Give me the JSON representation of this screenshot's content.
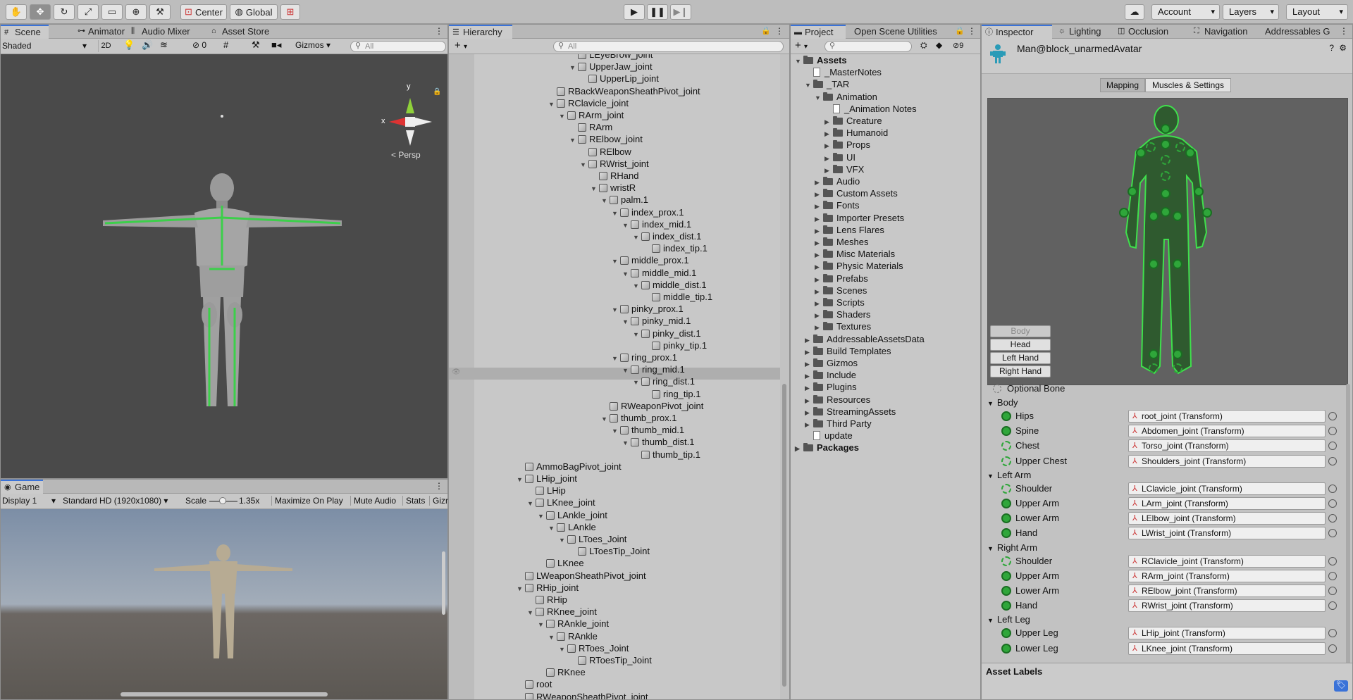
{
  "toolbar": {
    "center_label": "Center",
    "global_label": "Global",
    "account_label": "Account",
    "layers_label": "Layers",
    "layout_label": "Layout"
  },
  "scene": {
    "tabs": [
      "Scene",
      "Animator",
      "Audio Mixer",
      "Asset Store"
    ],
    "shading_mode": "Shaded",
    "mode_2d": "2D",
    "hidden_count": "0",
    "gizmos_label": "Gizmos",
    "search_placeholder": "All",
    "persp_label": "Persp",
    "axis_x": "x",
    "axis_y": "y"
  },
  "game": {
    "tab": "Game",
    "display": "Display 1",
    "resolution": "Standard HD (1920x1080)",
    "scale_label": "Scale",
    "scale_value": "1.35x",
    "maximize": "Maximize On Play",
    "mute": "Mute Audio",
    "stats": "Stats",
    "gizmos": "Gizm"
  },
  "hierarchy": {
    "tab": "Hierarchy",
    "search_placeholder": "All",
    "rows": [
      {
        "label": "LEyeBrow_joint",
        "depth": 9,
        "arrow": ""
      },
      {
        "label": "UpperJaw_joint",
        "depth": 9,
        "arrow": "▼"
      },
      {
        "label": "UpperLip_joint",
        "depth": 10,
        "arrow": ""
      },
      {
        "label": "RBackWeaponSheathPivot_joint",
        "depth": 7,
        "arrow": ""
      },
      {
        "label": "RClavicle_joint",
        "depth": 7,
        "arrow": "▼"
      },
      {
        "label": "RArm_joint",
        "depth": 8,
        "arrow": "▼"
      },
      {
        "label": "RArm",
        "depth": 9,
        "arrow": ""
      },
      {
        "label": "RElbow_joint",
        "depth": 9,
        "arrow": "▼"
      },
      {
        "label": "RElbow",
        "depth": 10,
        "arrow": ""
      },
      {
        "label": "RWrist_joint",
        "depth": 10,
        "arrow": "▼"
      },
      {
        "label": "RHand",
        "depth": 11,
        "arrow": ""
      },
      {
        "label": "wristR",
        "depth": 11,
        "arrow": "▼"
      },
      {
        "label": "palm.1",
        "depth": 12,
        "arrow": "▼"
      },
      {
        "label": "index_prox.1",
        "depth": 13,
        "arrow": "▼"
      },
      {
        "label": "index_mid.1",
        "depth": 14,
        "arrow": "▼"
      },
      {
        "label": "index_dist.1",
        "depth": 15,
        "arrow": "▼"
      },
      {
        "label": "index_tip.1",
        "depth": 16,
        "arrow": ""
      },
      {
        "label": "middle_prox.1",
        "depth": 13,
        "arrow": "▼"
      },
      {
        "label": "middle_mid.1",
        "depth": 14,
        "arrow": "▼"
      },
      {
        "label": "middle_dist.1",
        "depth": 15,
        "arrow": "▼"
      },
      {
        "label": "middle_tip.1",
        "depth": 16,
        "arrow": ""
      },
      {
        "label": "pinky_prox.1",
        "depth": 13,
        "arrow": "▼"
      },
      {
        "label": "pinky_mid.1",
        "depth": 14,
        "arrow": "▼"
      },
      {
        "label": "pinky_dist.1",
        "depth": 15,
        "arrow": "▼"
      },
      {
        "label": "pinky_tip.1",
        "depth": 16,
        "arrow": ""
      },
      {
        "label": "ring_prox.1",
        "depth": 13,
        "arrow": "▼"
      },
      {
        "label": "ring_mid.1",
        "depth": 14,
        "arrow": "▼"
      },
      {
        "label": "ring_dist.1",
        "depth": 15,
        "arrow": "▼"
      },
      {
        "label": "ring_tip.1",
        "depth": 16,
        "arrow": ""
      },
      {
        "label": "RWeaponPivot_joint",
        "depth": 12,
        "arrow": ""
      },
      {
        "label": "thumb_prox.1",
        "depth": 12,
        "arrow": "▼"
      },
      {
        "label": "thumb_mid.1",
        "depth": 13,
        "arrow": "▼"
      },
      {
        "label": "thumb_dist.1",
        "depth": 14,
        "arrow": "▼"
      },
      {
        "label": "thumb_tip.1",
        "depth": 15,
        "arrow": ""
      },
      {
        "label": "AmmoBagPivot_joint",
        "depth": 4,
        "arrow": ""
      },
      {
        "label": "LHip_joint",
        "depth": 4,
        "arrow": "▼"
      },
      {
        "label": "LHip",
        "depth": 5,
        "arrow": ""
      },
      {
        "label": "LKnee_joint",
        "depth": 5,
        "arrow": "▼"
      },
      {
        "label": "LAnkle_joint",
        "depth": 6,
        "arrow": "▼"
      },
      {
        "label": "LAnkle",
        "depth": 7,
        "arrow": "▼"
      },
      {
        "label": "LToes_Joint",
        "depth": 8,
        "arrow": "▼"
      },
      {
        "label": "LToesTip_Joint",
        "depth": 9,
        "arrow": ""
      },
      {
        "label": "LKnee",
        "depth": 6,
        "arrow": ""
      },
      {
        "label": "LWeaponSheathPivot_joint",
        "depth": 4,
        "arrow": ""
      },
      {
        "label": "RHip_joint",
        "depth": 4,
        "arrow": "▼"
      },
      {
        "label": "RHip",
        "depth": 5,
        "arrow": ""
      },
      {
        "label": "RKnee_joint",
        "depth": 5,
        "arrow": "▼"
      },
      {
        "label": "RAnkle_joint",
        "depth": 6,
        "arrow": "▼"
      },
      {
        "label": "RAnkle",
        "depth": 7,
        "arrow": "▼"
      },
      {
        "label": "RToes_Joint",
        "depth": 8,
        "arrow": "▼"
      },
      {
        "label": "RToesTip_Joint",
        "depth": 9,
        "arrow": ""
      },
      {
        "label": "RKnee",
        "depth": 6,
        "arrow": ""
      },
      {
        "label": "root",
        "depth": 4,
        "arrow": ""
      },
      {
        "label": "RWeaponSheathPivot_joint",
        "depth": 4,
        "arrow": ""
      }
    ]
  },
  "project": {
    "tabs": [
      "Project",
      "Open Scene Utilities"
    ],
    "hidden_count": "9",
    "rows": [
      {
        "label": "Assets",
        "depth": 0,
        "arrow": "▼",
        "icon": "folder",
        "bold": true
      },
      {
        "label": "_MasterNotes",
        "depth": 1,
        "arrow": "",
        "icon": "doc"
      },
      {
        "label": "_TAR",
        "depth": 1,
        "arrow": "▼",
        "icon": "folder"
      },
      {
        "label": "Animation",
        "depth": 2,
        "arrow": "▼",
        "icon": "folder"
      },
      {
        "label": "_Animation Notes",
        "depth": 3,
        "arrow": "",
        "icon": "doc"
      },
      {
        "label": "Creature",
        "depth": 3,
        "arrow": "▶",
        "icon": "folder"
      },
      {
        "label": "Humanoid",
        "depth": 3,
        "arrow": "▶",
        "icon": "folder"
      },
      {
        "label": "Props",
        "depth": 3,
        "arrow": "▶",
        "icon": "folder"
      },
      {
        "label": "UI",
        "depth": 3,
        "arrow": "▶",
        "icon": "folder"
      },
      {
        "label": "VFX",
        "depth": 3,
        "arrow": "▶",
        "icon": "folder"
      },
      {
        "label": "Audio",
        "depth": 2,
        "arrow": "▶",
        "icon": "folder"
      },
      {
        "label": "Custom Assets",
        "depth": 2,
        "arrow": "▶",
        "icon": "folder"
      },
      {
        "label": "Fonts",
        "depth": 2,
        "arrow": "▶",
        "icon": "folder"
      },
      {
        "label": "Importer Presets",
        "depth": 2,
        "arrow": "▶",
        "icon": "folder"
      },
      {
        "label": "Lens Flares",
        "depth": 2,
        "arrow": "▶",
        "icon": "folder"
      },
      {
        "label": "Meshes",
        "depth": 2,
        "arrow": "▶",
        "icon": "folder"
      },
      {
        "label": "Misc Materials",
        "depth": 2,
        "arrow": "▶",
        "icon": "folder"
      },
      {
        "label": "Physic Materials",
        "depth": 2,
        "arrow": "▶",
        "icon": "folder"
      },
      {
        "label": "Prefabs",
        "depth": 2,
        "arrow": "▶",
        "icon": "folder"
      },
      {
        "label": "Scenes",
        "depth": 2,
        "arrow": "▶",
        "icon": "folder"
      },
      {
        "label": "Scripts",
        "depth": 2,
        "arrow": "▶",
        "icon": "folder"
      },
      {
        "label": "Shaders",
        "depth": 2,
        "arrow": "▶",
        "icon": "folder"
      },
      {
        "label": "Textures",
        "depth": 2,
        "arrow": "▶",
        "icon": "folder"
      },
      {
        "label": "AddressableAssetsData",
        "depth": 1,
        "arrow": "▶",
        "icon": "folder"
      },
      {
        "label": "Build Templates",
        "depth": 1,
        "arrow": "▶",
        "icon": "folder"
      },
      {
        "label": "Gizmos",
        "depth": 1,
        "arrow": "▶",
        "icon": "folder"
      },
      {
        "label": "Include",
        "depth": 1,
        "arrow": "▶",
        "icon": "folder"
      },
      {
        "label": "Plugins",
        "depth": 1,
        "arrow": "▶",
        "icon": "folder"
      },
      {
        "label": "Resources",
        "depth": 1,
        "arrow": "▶",
        "icon": "folder"
      },
      {
        "label": "StreamingAssets",
        "depth": 1,
        "arrow": "▶",
        "icon": "folder"
      },
      {
        "label": "Third Party",
        "depth": 1,
        "arrow": "▶",
        "icon": "folder"
      },
      {
        "label": "update",
        "depth": 1,
        "arrow": "",
        "icon": "doc"
      },
      {
        "label": "Packages",
        "depth": 0,
        "arrow": "▶",
        "icon": "folder",
        "bold": true
      }
    ]
  },
  "inspector": {
    "tabs": [
      "Inspector",
      "Lighting",
      "Occlusion",
      "Navigation",
      "Addressables G"
    ],
    "object_name": "Man@block_unarmedAvatar",
    "mode_tabs": [
      "Mapping",
      "Muscles & Settings"
    ],
    "body_buttons": [
      "Body",
      "Head",
      "Left Hand",
      "Right Hand"
    ],
    "optional_bone": "Optional Bone",
    "sections": [
      {
        "title": "Body",
        "items": [
          {
            "label": "Hips",
            "value": "root_joint (Transform)",
            "optional": false
          },
          {
            "label": "Spine",
            "value": "Abdomen_joint (Transform)",
            "optional": false
          },
          {
            "label": "Chest",
            "value": "Torso_joint (Transform)",
            "optional": true
          },
          {
            "label": "Upper Chest",
            "value": "Shoulders_joint (Transform)",
            "optional": true
          }
        ]
      },
      {
        "title": "Left Arm",
        "items": [
          {
            "label": "Shoulder",
            "value": "LClavicle_joint (Transform)",
            "optional": true
          },
          {
            "label": "Upper Arm",
            "value": "LArm_joint (Transform)",
            "optional": false
          },
          {
            "label": "Lower Arm",
            "value": "LElbow_joint (Transform)",
            "optional": false
          },
          {
            "label": "Hand",
            "value": "LWrist_joint (Transform)",
            "optional": false
          }
        ]
      },
      {
        "title": "Right Arm",
        "items": [
          {
            "label": "Shoulder",
            "value": "RClavicle_joint (Transform)",
            "optional": true
          },
          {
            "label": "Upper Arm",
            "value": "RArm_joint (Transform)",
            "optional": false
          },
          {
            "label": "Lower Arm",
            "value": "RElbow_joint (Transform)",
            "optional": false
          },
          {
            "label": "Hand",
            "value": "RWrist_joint (Transform)",
            "optional": false
          }
        ]
      },
      {
        "title": "Left Leg",
        "items": [
          {
            "label": "Upper Leg",
            "value": "LHip_joint (Transform)",
            "optional": false
          },
          {
            "label": "Lower Leg",
            "value": "LKnee_joint (Transform)",
            "optional": false
          }
        ]
      }
    ],
    "asset_labels": "Asset Labels"
  },
  "colors": {
    "bone_green": "#2fa63a",
    "accent_blue": "#3a72d8"
  }
}
